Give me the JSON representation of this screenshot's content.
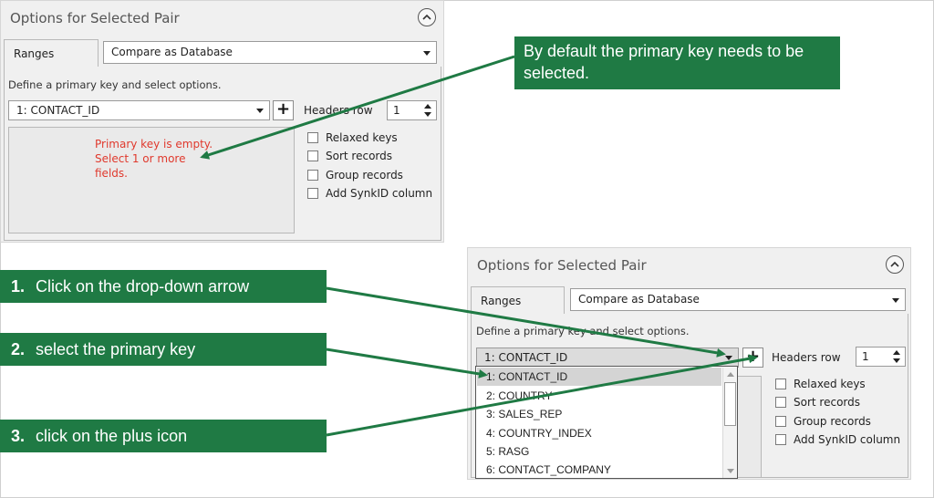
{
  "panel_top": {
    "title": "Options for Selected Pair",
    "tab_label": "Ranges",
    "compare_mode": "Compare as Database",
    "define_text": "Define a primary key and select options.",
    "key_select_value": "1: CONTACT_ID",
    "plus_label": "+",
    "headers_row_label": "Headers row",
    "headers_row_value": "1",
    "empty_warning_lines": [
      "Primary key is empty.",
      "Select 1 or more",
      "fields."
    ],
    "options": [
      "Relaxed keys",
      "Sort records",
      "Group records",
      "Add SynkID column"
    ]
  },
  "panel_bottom": {
    "title": "Options for Selected Pair",
    "tab_label": "Ranges",
    "compare_mode": "Compare as Database",
    "define_text": "Define a primary key and select options.",
    "key_select_value": "1: CONTACT_ID",
    "plus_label": "+",
    "headers_row_label": "Headers row",
    "headers_row_value": "1",
    "dropdown_items": [
      "1: CONTACT_ID",
      "2: COUNTRY",
      "3: SALES_REP",
      "4: COUNTRY_INDEX",
      "5: RASG",
      "6: CONTACT_COMPANY"
    ],
    "dropdown_selected_index": 0,
    "options": [
      "Relaxed keys",
      "Sort records",
      "Group records",
      "Add SynkID column"
    ]
  },
  "callouts": {
    "top_note": [
      "By default the primary key needs to be",
      "selected."
    ],
    "steps": [
      {
        "num": "1.",
        "text": "Click on the drop-down arrow"
      },
      {
        "num": "2.",
        "text": "select the primary key"
      },
      {
        "num": "3.",
        "text": "click on the plus icon"
      }
    ]
  },
  "colors": {
    "callout_bg": "#1f7a44",
    "warning_text": "#e0392d",
    "arrow": "#1f7a44"
  }
}
